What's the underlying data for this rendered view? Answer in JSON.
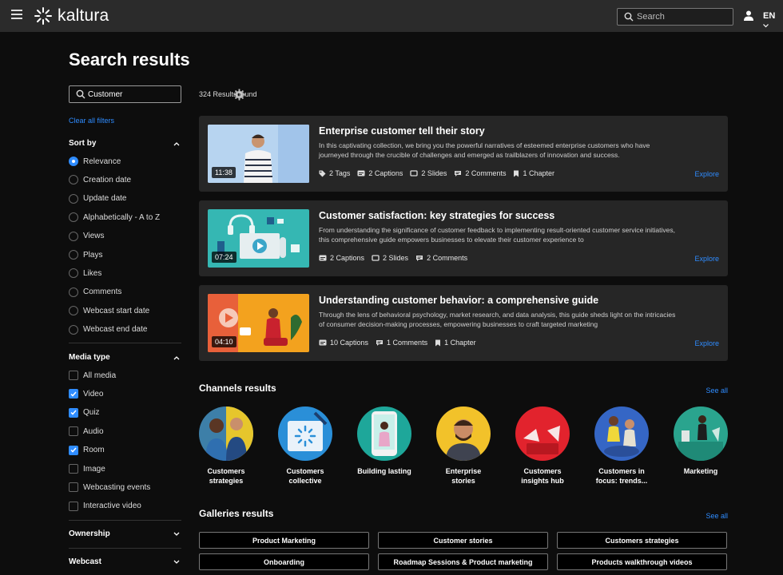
{
  "header": {
    "brand": "kaltura",
    "search_placeholder": "Search",
    "language": "EN"
  },
  "page_title": "Search results",
  "sidebar": {
    "search_value": "Customer",
    "clear_filters": "Clear all filters",
    "sort_by": {
      "title": "Sort by",
      "options": [
        "Relevance",
        "Creation date",
        "Update date",
        "Alphabetically - A to Z",
        "Views",
        "Plays",
        "Likes",
        "Comments",
        "Webcast start date",
        "Webcast end date"
      ],
      "selected": "Relevance"
    },
    "media_type": {
      "title": "Media type",
      "options": [
        "All media",
        "Video",
        "Quiz",
        "Audio",
        "Room",
        "Image",
        "Webcasting events",
        "Interactive video"
      ],
      "checked": [
        "Video",
        "Quiz",
        "Room"
      ]
    },
    "ownership": "Ownership",
    "webcast": "Webcast"
  },
  "results": {
    "count": "324 Results found",
    "items": [
      {
        "title": "Enterprise customer tell their story",
        "description": "In this captivating collection, we bring you the powerful narratives of esteemed enterprise customers who have journeyed through the crucible of challenges and emerged as trailblazers of innovation and success.",
        "duration": "11:38",
        "meta": [
          "2 Tags",
          "2 Captions",
          "2 Slides",
          "2 Comments",
          "1 Chapter"
        ],
        "action": "Explore"
      },
      {
        "title": "Customer satisfaction: key strategies for success",
        "description": "From understanding the significance of customer feedback to implementing result-oriented customer service initiatives, this comprehensive guide empowers businesses to elevate their customer experience to",
        "duration": "07:24",
        "meta": [
          "2 Captions",
          "2 Slides",
          "2 Comments"
        ],
        "action": "Explore"
      },
      {
        "title": "Understanding customer behavior: a comprehensive guide",
        "description": "Through the lens of behavioral psychology, market research, and data analysis, this guide sheds light on the intricacies of consumer decision-making processes, empowering businesses to craft targeted marketing",
        "duration": "04:10",
        "meta": [
          "10 Captions",
          "1 Comments",
          "1 Chapter"
        ],
        "action": "Explore"
      }
    ]
  },
  "channels": {
    "title": "Channels results",
    "see_all": "See all",
    "items": [
      {
        "line1": "Customers",
        "line2": "strategies"
      },
      {
        "line1": "Customers",
        "line2": "collective"
      },
      {
        "line1": "Building lasting",
        "line2": ""
      },
      {
        "line1": "Enterprise",
        "line2": "stories"
      },
      {
        "line1": "Customers",
        "line2": "insights hub"
      },
      {
        "line1": "Customers in",
        "line2": "focus: trends..."
      },
      {
        "line1": "Marketing",
        "line2": ""
      }
    ]
  },
  "galleries": {
    "title": "Galleries results",
    "see_all": "See all",
    "items": [
      "Product Marketing",
      "Customer stories",
      "Customers strategies",
      "Onboarding",
      "Roadmap Sessions & Product marketing",
      "Products walkthrough videos"
    ]
  }
}
